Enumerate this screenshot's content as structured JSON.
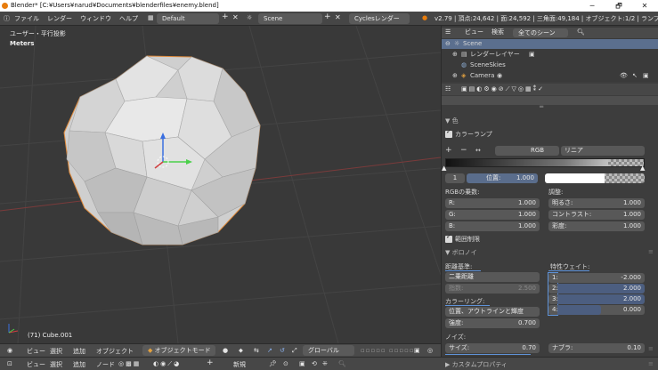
{
  "title": "Blender* [C:¥Users¥narud¥Documents¥blenderfiles¥enemy.blend]",
  "window_controls": [
    "─",
    "🗗",
    "✕"
  ],
  "menubar": {
    "items": [
      "ファイル",
      "レンダー",
      "ウィンドウ",
      "ヘルプ"
    ],
    "layout": "Default",
    "scene": "Scene",
    "engine": "Cyclesレンダー",
    "stats": "v2.79 | 頂点:24,642 | 面:24,592 | 三角面:49,184 | オブジェクト:1/2 | ランプ:0/0 | メモリ"
  },
  "viewport": {
    "view_label": "ユーザー・平行投影",
    "units": "Meters",
    "object_info": "(71) Cube.001",
    "colors": {
      "bg": "#393939",
      "rock": "#d8d8d8",
      "outline": "#e08a3a",
      "grid": "#444444"
    }
  },
  "vp_toolbar": {
    "items": [
      "ビュー",
      "選択",
      "追加",
      "オブジェクト"
    ],
    "mode": "オブジェクトモード",
    "orientation": "グローバル"
  },
  "node_bar": {
    "items": [
      "ビュー",
      "選択",
      "追加",
      "ノード"
    ],
    "new_label": "新規"
  },
  "outliner": {
    "header": [
      "ビュー",
      "検索",
      "全てのシーン"
    ],
    "items": [
      "Scene",
      "レンダーレイヤー",
      "SceneSkies",
      "Camera"
    ]
  },
  "props": {
    "section_color": "色",
    "colorramp_label": "カラーランプ",
    "ramp_mode": "RGB",
    "ramp_interp": "リニア",
    "ramp_controls": [
      "+",
      "−",
      "↔"
    ],
    "stop_index": "1",
    "position_label": "位置:",
    "position_value": "1.000",
    "rgb_factor_label": "RGBの乗数:",
    "adjust_label": "調整:",
    "r_label": "R:",
    "r_value": "1.000",
    "g_label": "G:",
    "g_value": "1.000",
    "b_label": "B:",
    "b_value": "1.000",
    "brightness_label": "明るさ:",
    "brightness_value": "1.000",
    "contrast_label": "コントラスト:",
    "contrast_value": "1.000",
    "saturation_label": "彩度:",
    "saturation_value": "1.000",
    "clamp_label": "範囲制限",
    "voronoi_label": "ボロノイ",
    "distance_label": "距離基準:",
    "distance_value": "二乗距離",
    "exponent_label": "指数:",
    "exponent_value": "2.500",
    "coloring_label": "カラーリング:",
    "coloring_value": "位置、アウトラインと輝度",
    "intensity_label": "強度:",
    "intensity_value": "0.700",
    "feature_label": "特性ウェイト:",
    "weights": [
      {
        "label": "1:",
        "value": "-2.000",
        "fill": 0
      },
      {
        "label": "2:",
        "value": "2.000",
        "fill": 1
      },
      {
        "label": "3:",
        "value": "2.000",
        "fill": 1
      },
      {
        "label": "4:",
        "value": "0.000",
        "fill": 0.5
      }
    ],
    "noise_label": "ノイズ:",
    "size_label": "サイズ:",
    "size_value": "0.70",
    "nabla_label": "ナブラ:",
    "nabla_value": "0.10",
    "custom_props": "カスタムプロパティ"
  }
}
